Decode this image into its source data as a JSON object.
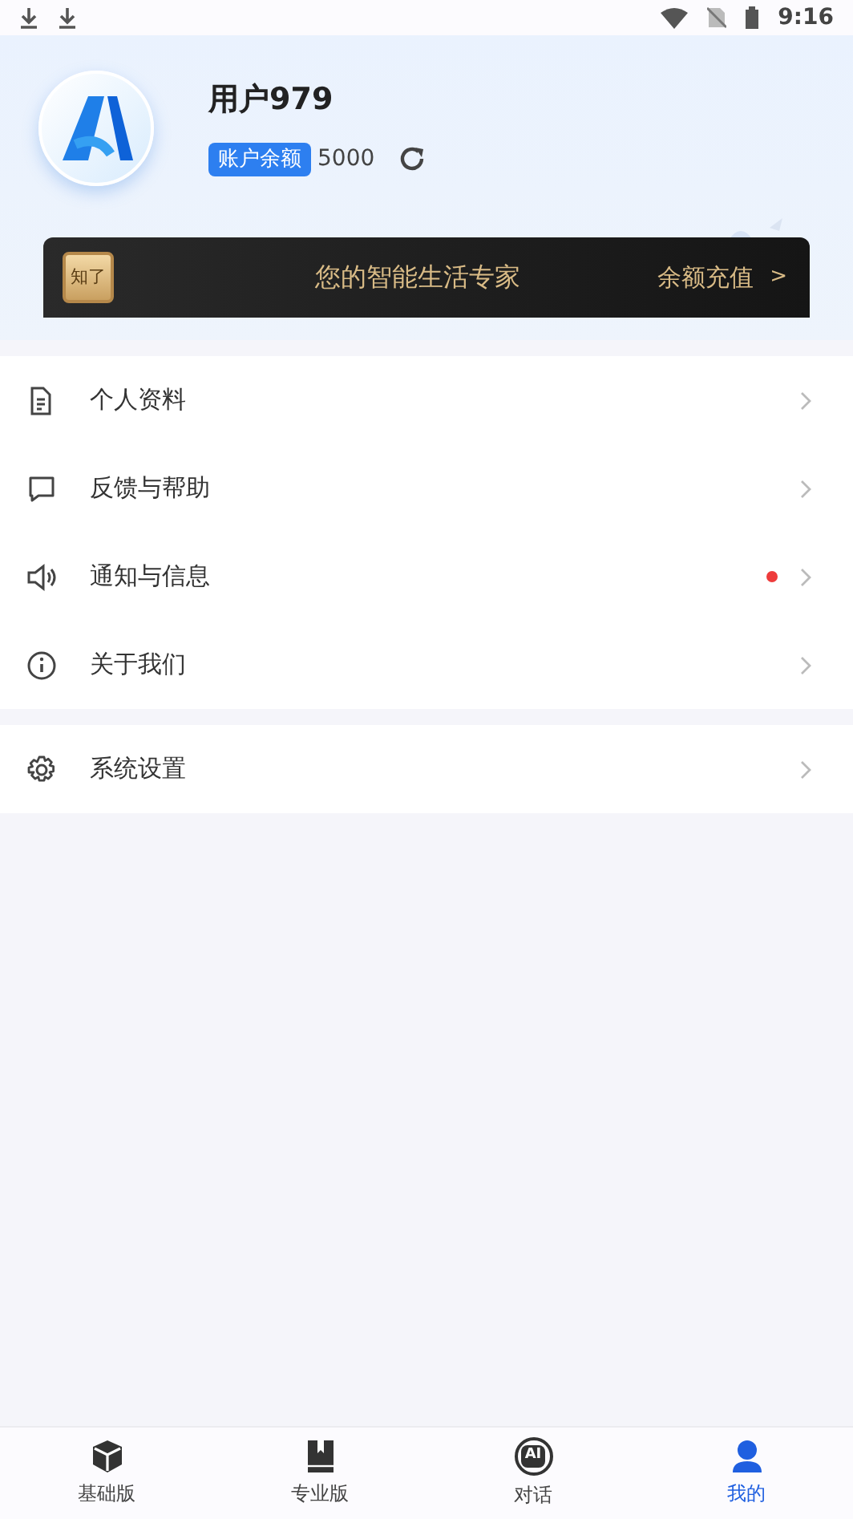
{
  "status_bar": {
    "time": "9:16"
  },
  "profile": {
    "username": "用户979",
    "balance_label": "账户余额",
    "balance": "5000"
  },
  "vip_banner": {
    "badge_text": "知了",
    "slogan": "您的智能生活专家",
    "action": "余额充值",
    "arrow": ">"
  },
  "menu_groups": [
    {
      "items": [
        {
          "kind": "document",
          "label": "个人资料",
          "has_dot": false
        },
        {
          "kind": "chat",
          "label": "反馈与帮助",
          "has_dot": false
        },
        {
          "kind": "speaker",
          "label": "通知与信息",
          "has_dot": true
        },
        {
          "kind": "info",
          "label": "关于我们",
          "has_dot": false
        }
      ]
    },
    {
      "items": [
        {
          "kind": "gear",
          "label": "系统设置",
          "has_dot": false
        }
      ]
    }
  ],
  "bottom_nav": [
    {
      "kind": "cube",
      "label": "基础版",
      "selected": false
    },
    {
      "kind": "book",
      "label": "专业版",
      "selected": false
    },
    {
      "kind": "ai",
      "label": "对话",
      "icon_text": "AI",
      "selected": false
    },
    {
      "kind": "person",
      "label": "我的",
      "selected": true
    }
  ]
}
